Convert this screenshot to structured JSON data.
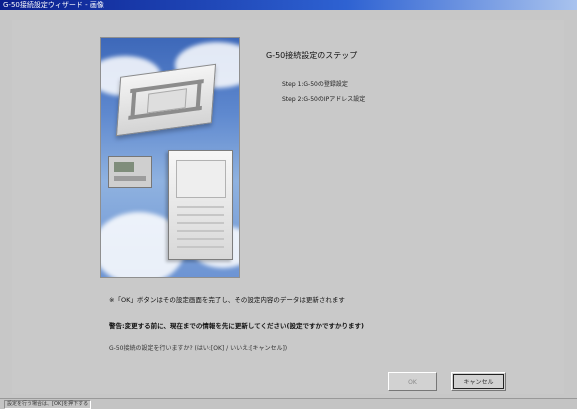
{
  "window": {
    "title": "G-50接続設定ウィザード - 画像"
  },
  "steps": {
    "title": "G-50接続設定のステップ",
    "items": [
      "Step 1:G-50の登録設定",
      "Step 2:G-50のIPアドレス設定"
    ]
  },
  "messages": {
    "info": "※「OK」ボタンはその設定画面を完了し、その設定内容のデータは更新されます",
    "warning": "警告:変更する前に、現在までの情報を先に更新してください(設定ですかですかります)",
    "question": "G-50接続の設定を行いますか? (はい:[OK] / いいえ:[キャンセル])"
  },
  "buttons": {
    "ok": "OK",
    "cancel": "キャンセル"
  },
  "statusbar": {
    "text": "設定を行う場合は、[OK]を押下する"
  }
}
